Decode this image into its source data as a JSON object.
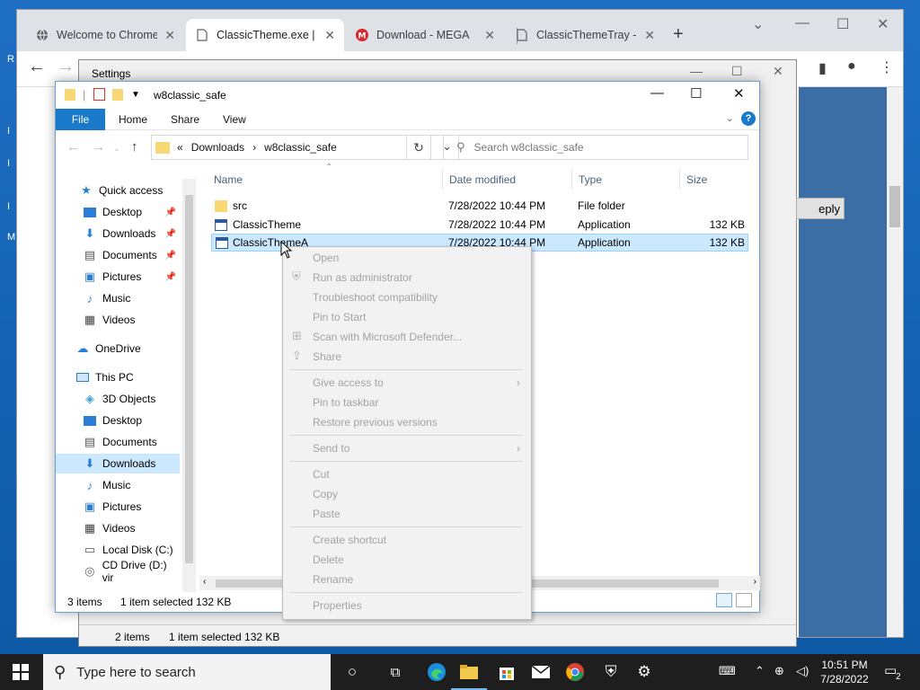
{
  "desktop": {
    "glyphs": [
      "R",
      "I",
      "I",
      "I",
      "M"
    ]
  },
  "chrome": {
    "tabs": [
      {
        "title": "Welcome to Chrome",
        "icon": "globe-icon"
      },
      {
        "title": "ClassicTheme.exe | W",
        "icon": "page-icon",
        "active": true
      },
      {
        "title": "Download - MEGA",
        "icon": "mega-icon"
      },
      {
        "title": "ClassicThemeTray - g",
        "icon": "page-icon"
      }
    ],
    "new_tab": "+"
  },
  "settings": {
    "title": "Settings",
    "status": {
      "items": "2 items",
      "selected": "1 item selected  132 KB"
    },
    "reply_label": "eply"
  },
  "explorer": {
    "title": "w8classic_safe",
    "ribbon": {
      "file": "File",
      "home": "Home",
      "share": "Share",
      "view": "View"
    },
    "address": {
      "prefix": "«",
      "crumbs": [
        "Downloads",
        "w8classic_safe"
      ]
    },
    "search_placeholder": "Search w8classic_safe",
    "nav": [
      {
        "label": "Quick access",
        "icon": "star-icon"
      },
      {
        "label": "Desktop",
        "icon": "desktop-icon",
        "pinned": true
      },
      {
        "label": "Downloads",
        "icon": "download-arrow-icon",
        "pinned": true
      },
      {
        "label": "Documents",
        "icon": "document-icon",
        "pinned": true
      },
      {
        "label": "Pictures",
        "icon": "pictures-icon",
        "pinned": true
      },
      {
        "label": "Music",
        "icon": "music-icon"
      },
      {
        "label": "Videos",
        "icon": "video-icon"
      },
      {
        "label": "OneDrive",
        "icon": "cloud-icon"
      },
      {
        "label": "This PC",
        "icon": "computer-icon"
      },
      {
        "label": "3D Objects",
        "icon": "cube-icon"
      },
      {
        "label": "Desktop",
        "icon": "desktop-icon"
      },
      {
        "label": "Documents",
        "icon": "document-icon"
      },
      {
        "label": "Downloads",
        "icon": "download-arrow-icon",
        "selected": true
      },
      {
        "label": "Music",
        "icon": "music-icon"
      },
      {
        "label": "Pictures",
        "icon": "pictures-icon"
      },
      {
        "label": "Videos",
        "icon": "video-icon"
      },
      {
        "label": "Local Disk (C:)",
        "icon": "drive-icon"
      },
      {
        "label": "CD Drive (D:) vir",
        "icon": "cd-drive-icon"
      }
    ],
    "columns": {
      "name": "Name",
      "date": "Date modified",
      "type": "Type",
      "size": "Size"
    },
    "files": [
      {
        "name": "src",
        "date": "7/28/2022 10:44 PM",
        "type": "File folder",
        "size": "",
        "icon": "folder-icon"
      },
      {
        "name": "ClassicTheme",
        "date": "7/28/2022 10:44 PM",
        "type": "Application",
        "size": "132 KB",
        "icon": "app-icon"
      },
      {
        "name": "ClassicThemeA",
        "date": "7/28/2022 10:44 PM",
        "type": "Application",
        "size": "132 KB",
        "icon": "app-icon",
        "selected": true
      }
    ],
    "status": {
      "count": "3 items",
      "selected": "1 item selected  132 KB"
    }
  },
  "context_menu": {
    "items": [
      {
        "label": "Open"
      },
      {
        "label": "Run as administrator",
        "icon": "shield-icon"
      },
      {
        "label": "Troubleshoot compatibility"
      },
      {
        "label": "Pin to Start"
      },
      {
        "label": "Scan with Microsoft Defender...",
        "icon": "defender-icon"
      },
      {
        "label": "Share",
        "icon": "share-icon"
      },
      {
        "label": "Give access to",
        "submenu": true
      },
      {
        "label": "Pin to taskbar"
      },
      {
        "label": "Restore previous versions"
      },
      {
        "label": "Send to",
        "submenu": true
      },
      {
        "label": "Cut"
      },
      {
        "label": "Copy"
      },
      {
        "label": "Paste"
      },
      {
        "label": "Create shortcut"
      },
      {
        "label": "Delete"
      },
      {
        "label": "Rename"
      },
      {
        "label": "Properties"
      }
    ]
  },
  "taskbar": {
    "search_placeholder": "Type here to search",
    "time": "10:51 PM",
    "date": "7/28/2022",
    "notifications": "2"
  }
}
